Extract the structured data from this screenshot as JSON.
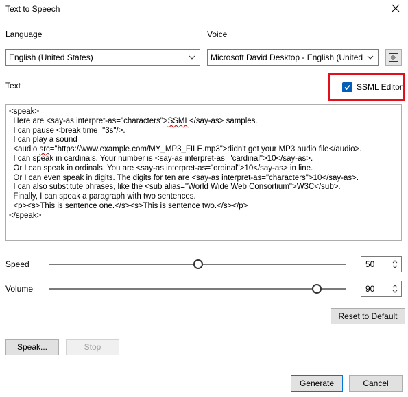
{
  "window": {
    "title": "Text to Speech"
  },
  "language": {
    "label": "Language",
    "selected": "English (United States)"
  },
  "voice": {
    "label": "Voice",
    "selected": "Microsoft David Desktop - English (United States)"
  },
  "text_section": {
    "label": "Text"
  },
  "ssml_editor": {
    "label": "SSML Editor",
    "checked": true
  },
  "text_content": {
    "lines": [
      "<speak>",
      "  Here are <say-as interpret-as=\"characters\">SSML</say-as> samples.",
      "  I can pause <break time=\"3s\"/>.",
      "  I can play a sound",
      "  <audio src=\"https://www.example.com/MY_MP3_FILE.mp3\">didn't get your MP3 audio file</audio>.",
      "  I can speak in cardinals. Your number is <say-as interpret-as=\"cardinal\">10</say-as>.",
      "  Or I can speak in ordinals. You are <say-as interpret-as=\"ordinal\">10</say-as> in line.",
      "  Or I can even speak in digits. The digits for ten are <say-as interpret-as=\"characters\">10</say-as>.",
      "  I can also substitute phrases, like the <sub alias=\"World Wide Web Consortium\">W3C</sub>.",
      "  Finally, I can speak a paragraph with two sentences.",
      "  <p><s>This is sentence one.</s><s>This is sentence two.</s></p>",
      "</speak>"
    ]
  },
  "speed": {
    "label": "Speed",
    "value": "50",
    "fraction": 0.5
  },
  "volume": {
    "label": "Volume",
    "value": "90",
    "fraction": 0.9
  },
  "buttons": {
    "reset": "Reset to Default",
    "speak": "Speak...",
    "stop": "Stop",
    "generate": "Generate",
    "cancel": "Cancel"
  },
  "colors": {
    "accent": "#005fb8",
    "highlight_border": "#e2101c"
  },
  "icons": {
    "close": "close-icon",
    "chevron": "chevron-down-icon",
    "voice_settings": "audio-settings-icon",
    "checkbox": "checkmark-icon",
    "spin_up": "chevron-up-icon",
    "spin_down": "chevron-down-icon"
  }
}
